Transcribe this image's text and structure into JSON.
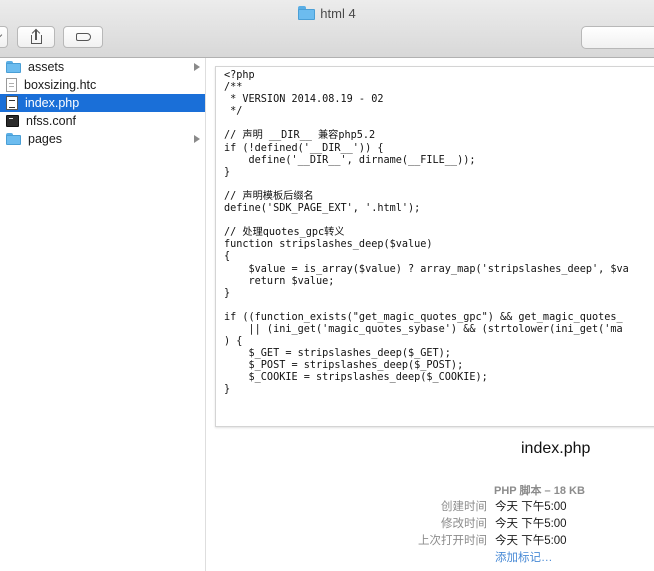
{
  "window": {
    "title": "html 4",
    "title_icon": "folder-icon"
  },
  "toolbar": {
    "share_icon": "share-icon",
    "tag_icon": "tag-icon",
    "search_placeholder": ""
  },
  "files": [
    {
      "name": "assets",
      "type": "folder",
      "icon": "folder-icon",
      "has_children": true,
      "selected": false
    },
    {
      "name": "boxsizing.htc",
      "type": "file",
      "icon": "document-icon",
      "has_children": false,
      "selected": false
    },
    {
      "name": "index.php",
      "type": "file",
      "icon": "php-file-icon",
      "has_children": false,
      "selected": true
    },
    {
      "name": "nfss.conf",
      "type": "file",
      "icon": "terminal-file-icon",
      "has_children": false,
      "selected": false
    },
    {
      "name": "pages",
      "type": "folder",
      "icon": "folder-icon",
      "has_children": true,
      "selected": false
    }
  ],
  "preview": {
    "code": "<?php\n/**\n * VERSION 2014.08.19 - 02\n */\n\n// 声明 __DIR__ 兼容php5.2\nif (!defined('__DIR__')) {\n    define('__DIR__', dirname(__FILE__));\n}\n\n// 声明模板后缀名\ndefine('SDK_PAGE_EXT', '.html');\n\n// 处理quotes_gpc转义\nfunction stripslashes_deep($value)\n{\n    $value = is_array($value) ? array_map('stripslashes_deep', $va\n    return $value;\n}\n\nif ((function_exists(\"get_magic_quotes_gpc\") && get_magic_quotes_\n    || (ini_get('magic_quotes_sybase') && (strtolower(ini_get('ma\n) {\n    $_GET = stripslashes_deep($_GET);\n    $_POST = stripslashes_deep($_POST);\n    $_COOKIE = stripslashes_deep($_COOKIE);\n}"
  },
  "info": {
    "filename": "index.php",
    "kind": "PHP 脚本 – 18 KB",
    "created_label": "创建时间",
    "created_value": "今天 下午5:00",
    "modified_label": "修改时间",
    "modified_value": "今天 下午5:00",
    "opened_label": "上次打开时间",
    "opened_value": "今天 下午5:00",
    "add_tags": "添加标记…"
  },
  "colors": {
    "selection": "#1a6fd8",
    "folder": "#6cbcef",
    "link": "#4a8bd6",
    "muted_text": "#8c8c8c"
  }
}
